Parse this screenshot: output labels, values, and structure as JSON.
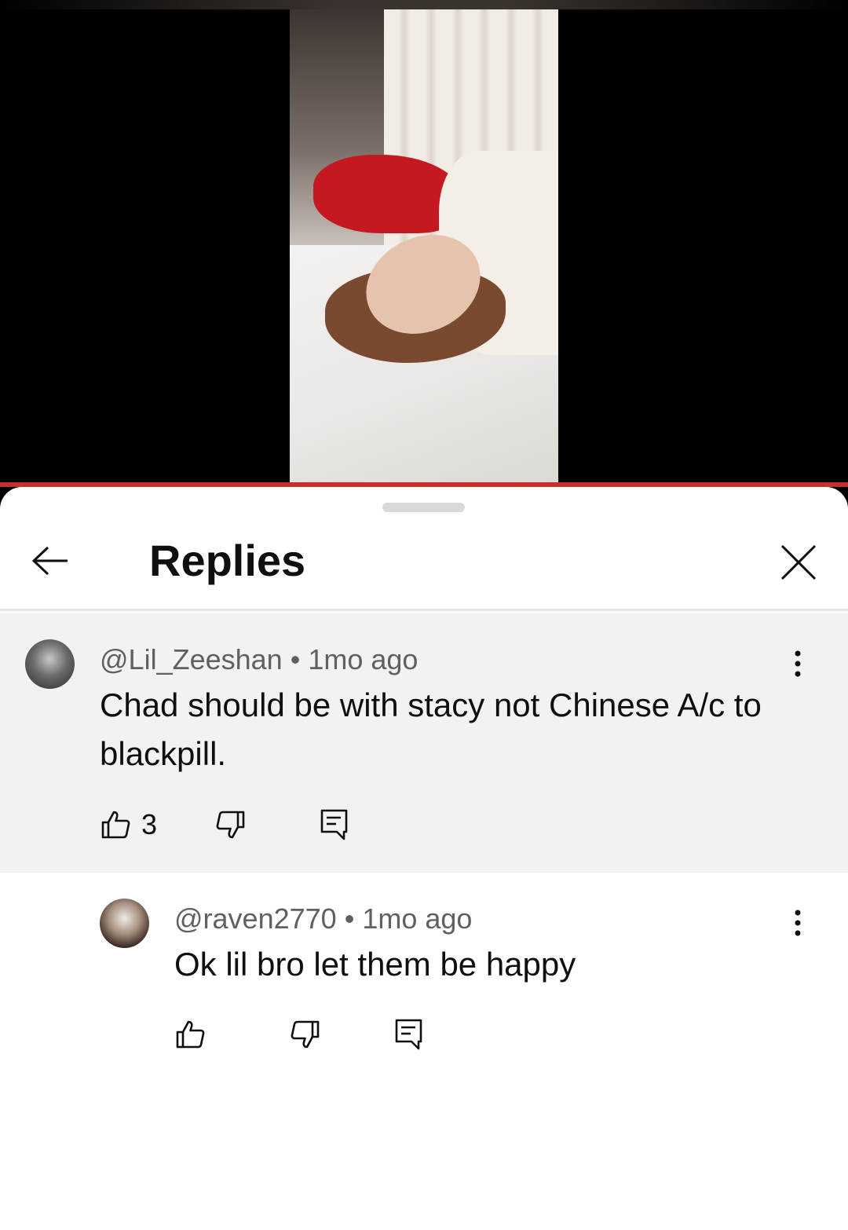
{
  "header": {
    "title": "Replies"
  },
  "comments": [
    {
      "author": "@Lil_Zeeshan",
      "separator": "•",
      "time": "1mo ago",
      "text": "Chad should be with stacy not Chinese A/c to blackpill.",
      "likes": "3"
    },
    {
      "author": "@raven2770",
      "separator": "•",
      "time": "1mo ago",
      "text": "Ok lil bro let them be happy",
      "likes": ""
    }
  ],
  "colors": {
    "progress": "#c4302b",
    "highlighted_comment_bg": "#f2f2f2",
    "meta_text": "#606060",
    "primary_text": "#0f0f0f"
  },
  "icons": {
    "back": "arrow-left-icon",
    "close": "close-icon",
    "more": "more-vert-icon",
    "like": "thumb-up-icon",
    "dislike": "thumb-down-icon",
    "reply": "reply-icon"
  }
}
